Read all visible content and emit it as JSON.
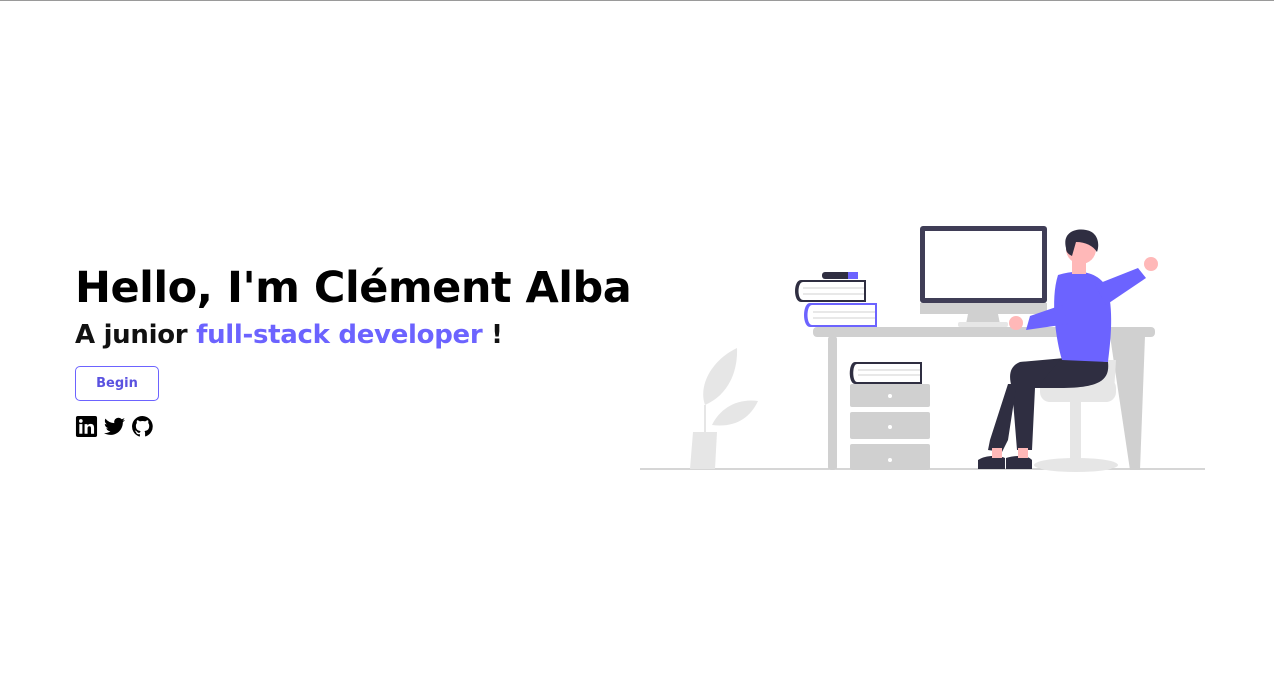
{
  "hero": {
    "title": "Hello, I'm Clément Alba",
    "subtitle_prefix": "A junior ",
    "subtitle_accent": "full-stack developer",
    "subtitle_suffix": " !",
    "begin_label": "Begin"
  },
  "socials": [
    {
      "icon": "linkedin-icon",
      "label": "LinkedIn"
    },
    {
      "icon": "twitter-icon",
      "label": "Twitter"
    },
    {
      "icon": "github-icon",
      "label": "GitHub"
    }
  ],
  "colors": {
    "accent": "#6c63ff",
    "text": "#000000",
    "illustration_gray": "#d0d0d0",
    "illustration_dark": "#2f2e41",
    "skin": "#ffb8b8"
  }
}
